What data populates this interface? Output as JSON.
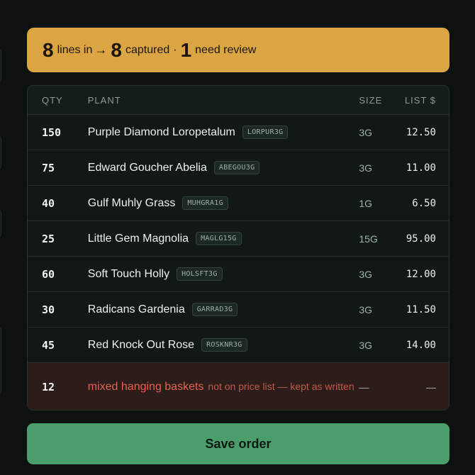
{
  "summary": {
    "lines_in": "8",
    "lines_in_label": "lines in",
    "arrow": "→",
    "captured": "8",
    "captured_label": "captured",
    "separator": "·",
    "review": "1",
    "review_label": "need review"
  },
  "table": {
    "headers": {
      "qty": "QTY",
      "plant": "PLANT",
      "size": "SIZE",
      "list": "LIST $"
    },
    "rows": [
      {
        "qty": "150",
        "name": "Purple Diamond Loropetalum",
        "code": "LORPUR3G",
        "size": "3G",
        "price": "12.50"
      },
      {
        "qty": "75",
        "name": "Edward Goucher Abelia",
        "code": "ABEGOU3G",
        "size": "3G",
        "price": "11.00"
      },
      {
        "qty": "40",
        "name": "Gulf Muhly Grass",
        "code": "MUHGRA1G",
        "size": "1G",
        "price": "6.50"
      },
      {
        "qty": "25",
        "name": "Little Gem Magnolia",
        "code": "MAGLG15G",
        "size": "15G",
        "price": "95.00"
      },
      {
        "qty": "60",
        "name": "Soft Touch Holly",
        "code": "HOLSFT3G",
        "size": "3G",
        "price": "12.00"
      },
      {
        "qty": "30",
        "name": "Radicans Gardenia",
        "code": "GARRAD3G",
        "size": "3G",
        "price": "11.50"
      },
      {
        "qty": "45",
        "name": "Red Knock Out Rose",
        "code": "ROSKNR3G",
        "size": "3G",
        "price": "14.00"
      }
    ],
    "flagged": {
      "qty": "12",
      "name": "mixed hanging baskets",
      "note": "not on price list — kept as written",
      "size": "—",
      "price": "—"
    }
  },
  "save_label": "Save order",
  "colors": {
    "summary_bg": "#dca544",
    "save_bg": "#4b9d6c",
    "flag_text": "#e5624e",
    "page_bg": "#0d1210"
  }
}
